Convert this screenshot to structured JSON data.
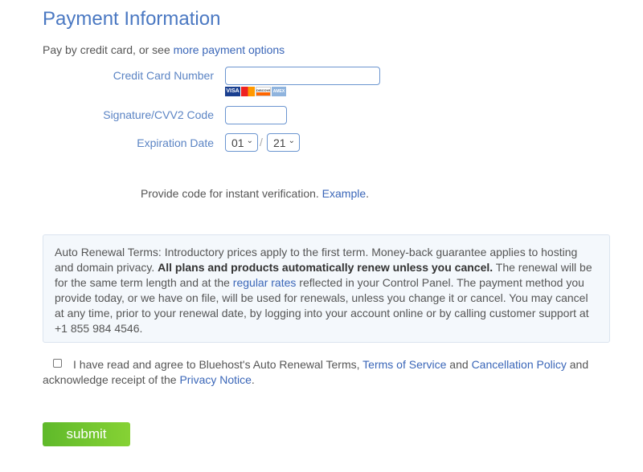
{
  "title": "Payment Information",
  "intro": {
    "text": "Pay by credit card, or see ",
    "link": "more payment options"
  },
  "fields": {
    "card_number_label": "Credit Card Number",
    "card_number_value": "",
    "cvv_label": "Signature/CVV2 Code",
    "cvv_value": "",
    "expiration_label": "Expiration Date",
    "month": "01",
    "separator": "/",
    "year": "21"
  },
  "cards": [
    "VISA",
    "MC",
    "DISCOVER",
    "AMEX"
  ],
  "verify": {
    "text": "Provide code for instant verification. ",
    "link": "Example",
    "end": "."
  },
  "terms": {
    "p1": "Auto Renewal Terms: Introductory prices apply to the first term. Money-back guarantee applies to hosting and domain privacy. ",
    "bold": "All plans and products automatically renew unless you cancel.",
    "p2": " The renewal will be for the same term length and at the ",
    "link": "regular rates",
    "p3": " reflected in your Control Panel. The payment method you provide today, or we have on file, will be used for renewals, unless you change it or cancel. You may cancel at any time, prior to your renewal date, by logging into your account online or by calling customer support at +1 855 984 4546."
  },
  "agree": {
    "t1": "I have read and agree to Bluehost's Auto Renewal Terms, ",
    "tos": "Terms of Service",
    "t2": " and ",
    "cancel": "Cancellation Policy",
    "t3": " and acknowledge receipt of the ",
    "privacy": "Privacy Notice",
    "t4": ".",
    "checked": false
  },
  "submit_label": "submit",
  "colors": {
    "accent": "#4a78c2",
    "link": "#3a66b8",
    "submit": "#6cc12e"
  }
}
